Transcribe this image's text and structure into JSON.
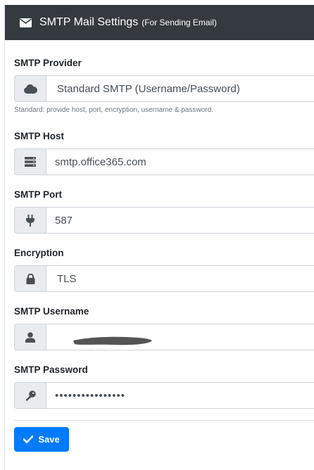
{
  "header": {
    "icon": "envelope-icon",
    "title": "SMTP Mail Settings",
    "subtitle": "(For Sending Email)"
  },
  "fields": {
    "provider": {
      "label": "SMTP Provider",
      "icon": "cloud-icon",
      "value": "Standard SMTP (Username/Password)",
      "help": "Standard: provide host, port, encryption, username & password."
    },
    "host": {
      "label": "SMTP Host",
      "icon": "server-icon",
      "value": "smtp.office365.com"
    },
    "port": {
      "label": "SMTP Port",
      "icon": "plug-icon",
      "value": "587"
    },
    "encryption": {
      "label": "Encryption",
      "icon": "lock-icon",
      "value": "TLS"
    },
    "username": {
      "label": "SMTP Username",
      "icon": "user-icon",
      "value": ""
    },
    "password": {
      "label": "SMTP Password",
      "icon": "key-icon",
      "value": "••••••••••••••••"
    }
  },
  "save": {
    "label": "Save",
    "icon": "check-icon"
  },
  "colors": {
    "header_bg": "#343a40",
    "primary": "#007bff",
    "addon_bg": "#e9ecef"
  }
}
